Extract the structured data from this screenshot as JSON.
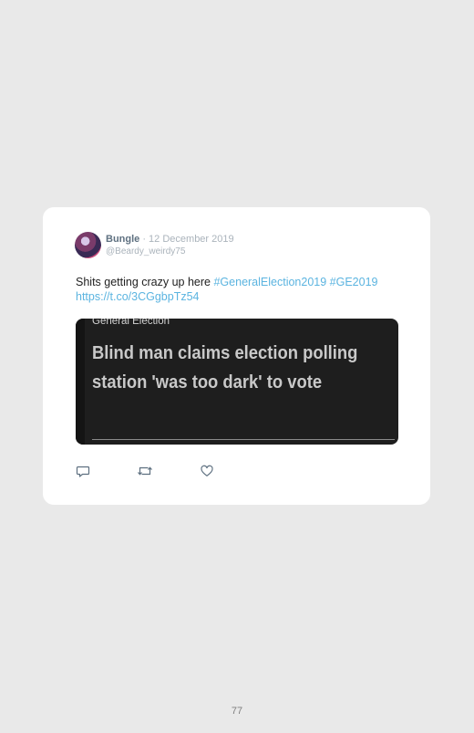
{
  "tweet": {
    "user_name": "Bungle",
    "date": " · 12 December 2019",
    "handle": "@Beardy_weirdy75",
    "text_plain": "Shits getting crazy up here ",
    "hashtag_1": "#GeneralElection2019",
    "hashtag_2": "#GE2019",
    "link": "https://t.co/3CGgbpTz54"
  },
  "preview": {
    "category": "General Election",
    "headline": "Blind man claims election polling station 'was too dark' to vote"
  },
  "actions": {
    "reply_icon": "reply-icon",
    "retweet_icon": "retweet-icon",
    "like_icon": "heart-icon"
  },
  "page": {
    "number": "77"
  },
  "colors": {
    "background": "#e9e9e9",
    "card": "#ffffff",
    "link": "#5bb4e0",
    "name": "#5e7080",
    "muted": "#aab3bb",
    "preview_bg": "#1e1e1e"
  }
}
